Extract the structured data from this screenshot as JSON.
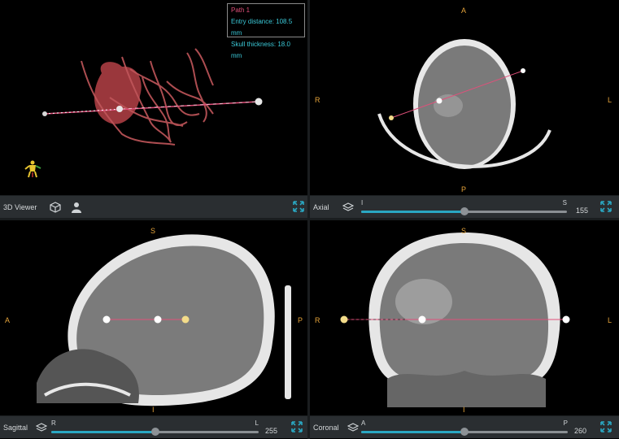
{
  "colors": {
    "accent": "#2aa7c2",
    "path": "#e0507a",
    "info": "#3bc9d8",
    "orient": "#e6a43a",
    "entry": "#f3dc8a"
  },
  "viewer3d": {
    "label": "3D Viewer",
    "info": {
      "title": "Path 1",
      "entry_distance": "Entry distance:  108.5  mm",
      "skull_thickness": "Skull thickness:  18.0  mm"
    }
  },
  "axial": {
    "label": "Axial",
    "orient": {
      "top": "A",
      "bottom": "P",
      "left": "R",
      "right": "L"
    },
    "slider": {
      "start": "I",
      "end": "S",
      "position": 0.5
    },
    "value": "155"
  },
  "sagittal": {
    "label": "Sagittal",
    "orient": {
      "top": "S",
      "bottom": "I",
      "left": "A",
      "right": "P"
    },
    "slider": {
      "start": "R",
      "end": "L",
      "position": 0.5
    },
    "value": "255"
  },
  "coronal": {
    "label": "Coronal",
    "orient": {
      "top": "S",
      "bottom": "I",
      "left": "R",
      "right": "L"
    },
    "slider": {
      "start": "A",
      "end": "P",
      "position": 0.5
    },
    "value": "260"
  },
  "icons": {
    "cube": "cube-icon",
    "person": "person-icon",
    "layers": "layers-icon",
    "expand": "expand-icon"
  }
}
